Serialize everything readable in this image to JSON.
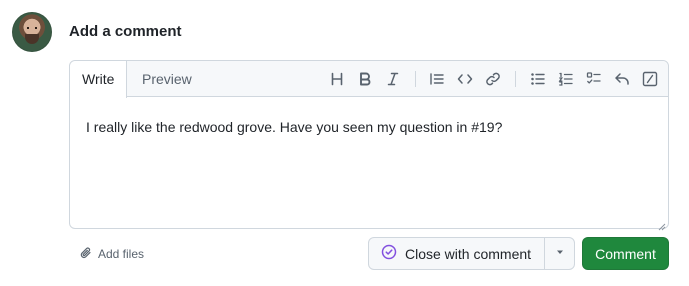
{
  "header": {
    "title": "Add a comment"
  },
  "editor": {
    "tabs": [
      {
        "label": "Write",
        "active": true
      },
      {
        "label": "Preview",
        "active": false
      }
    ],
    "toolbar": [
      {
        "name": "heading-icon"
      },
      {
        "name": "bold-icon"
      },
      {
        "name": "italic-icon"
      },
      {
        "name": "quote-icon"
      },
      {
        "name": "code-icon"
      },
      {
        "name": "link-icon"
      },
      {
        "name": "unordered-list-icon"
      },
      {
        "name": "ordered-list-icon"
      },
      {
        "name": "task-list-icon"
      },
      {
        "name": "reply-icon"
      },
      {
        "name": "slash-command-icon"
      }
    ],
    "text": "I really like the redwood grove. Have you seen my question in #19?"
  },
  "footer": {
    "add_files_label": "Add files",
    "close_label": "Close with comment",
    "comment_label": "Comment"
  },
  "colors": {
    "primary_button": "#1f883d",
    "close_icon": "#8250df",
    "border": "#d0d7de",
    "muted_text": "#59636e"
  }
}
